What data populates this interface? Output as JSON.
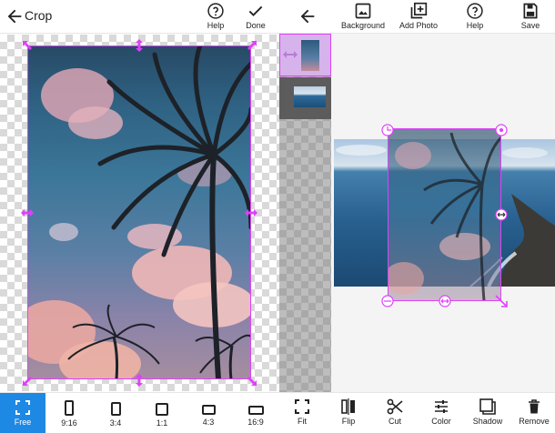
{
  "crop_screen": {
    "title": "Crop",
    "help_label": "Help",
    "done_label": "Done",
    "ratios": [
      {
        "label": "Free",
        "selected": true
      },
      {
        "label": "9:16",
        "selected": false
      },
      {
        "label": "3:4",
        "selected": false
      },
      {
        "label": "1:1",
        "selected": false
      },
      {
        "label": "4:3",
        "selected": false
      },
      {
        "label": "16:9",
        "selected": false
      }
    ]
  },
  "editor_screen": {
    "background_label": "Background",
    "add_photo_label": "Add Photo",
    "help_label": "Help",
    "save_label": "Save",
    "tools": [
      {
        "label": "Fit",
        "icon": "fit-icon"
      },
      {
        "label": "Flip",
        "icon": "flip-icon"
      },
      {
        "label": "Cut",
        "icon": "scissors-icon"
      },
      {
        "label": "Color",
        "icon": "sliders-icon"
      },
      {
        "label": "Shadow",
        "icon": "shadow-icon"
      },
      {
        "label": "Remove",
        "icon": "trash-icon"
      }
    ],
    "layer_thumbnails": [
      "palm-photo-layer",
      "ocean-photo-layer"
    ]
  },
  "colors": {
    "accent": "#1e88e5",
    "handle": "#e040fb",
    "frame": "#e040fb"
  }
}
